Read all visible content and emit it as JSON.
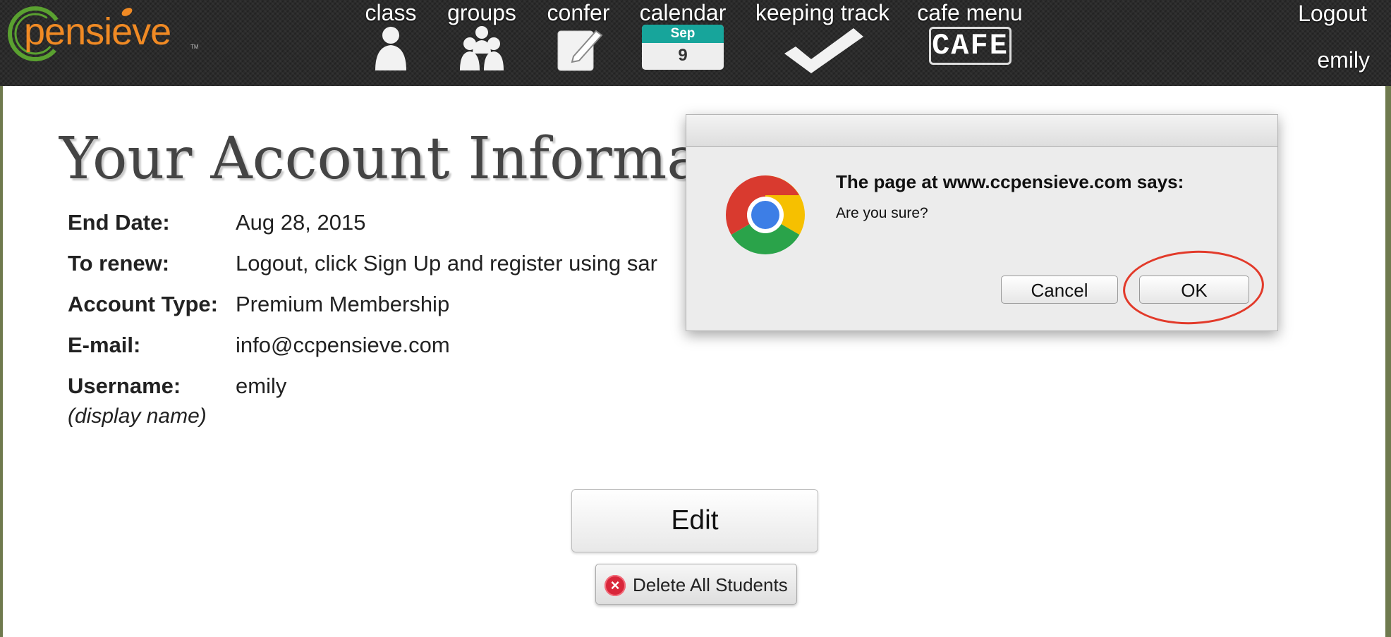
{
  "brand": {
    "name": "pensieve",
    "tm": "TM"
  },
  "nav": {
    "items": [
      {
        "id": "class",
        "label": "class"
      },
      {
        "id": "groups",
        "label": "groups"
      },
      {
        "id": "confer",
        "label": "confer"
      },
      {
        "id": "calendar",
        "label": "calendar",
        "month": "Sep",
        "day": "9"
      },
      {
        "id": "keeping-track",
        "label": "keeping track"
      },
      {
        "id": "cafe-menu",
        "label": "cafe menu",
        "badge": "CAFE"
      }
    ],
    "logout": "Logout",
    "user": "emily"
  },
  "page": {
    "title": "Your Account Informat",
    "fields": [
      {
        "label": "End Date:",
        "value": "Aug 28, 2015"
      },
      {
        "label": "To renew:",
        "value": "Logout, click Sign Up and register using sar"
      },
      {
        "label": "Account Type:",
        "value": "Premium Membership"
      },
      {
        "label": "E-mail:",
        "value": "info@ccpensieve.com"
      },
      {
        "label": "Username:",
        "value": "emily",
        "sublabel": "(display name)"
      }
    ],
    "edit_button": "Edit",
    "delete_button": "Delete All Students"
  },
  "dialog": {
    "heading": "The page at www.ccpensieve.com says:",
    "message": "Are you sure?",
    "cancel": "Cancel",
    "ok": "OK"
  },
  "colors": {
    "accent_orange": "#f08a24",
    "logo_green": "#5aa130",
    "calendar_teal": "#17a59b",
    "highlight_red": "#e23a2a",
    "delete_red": "#d9263a"
  }
}
